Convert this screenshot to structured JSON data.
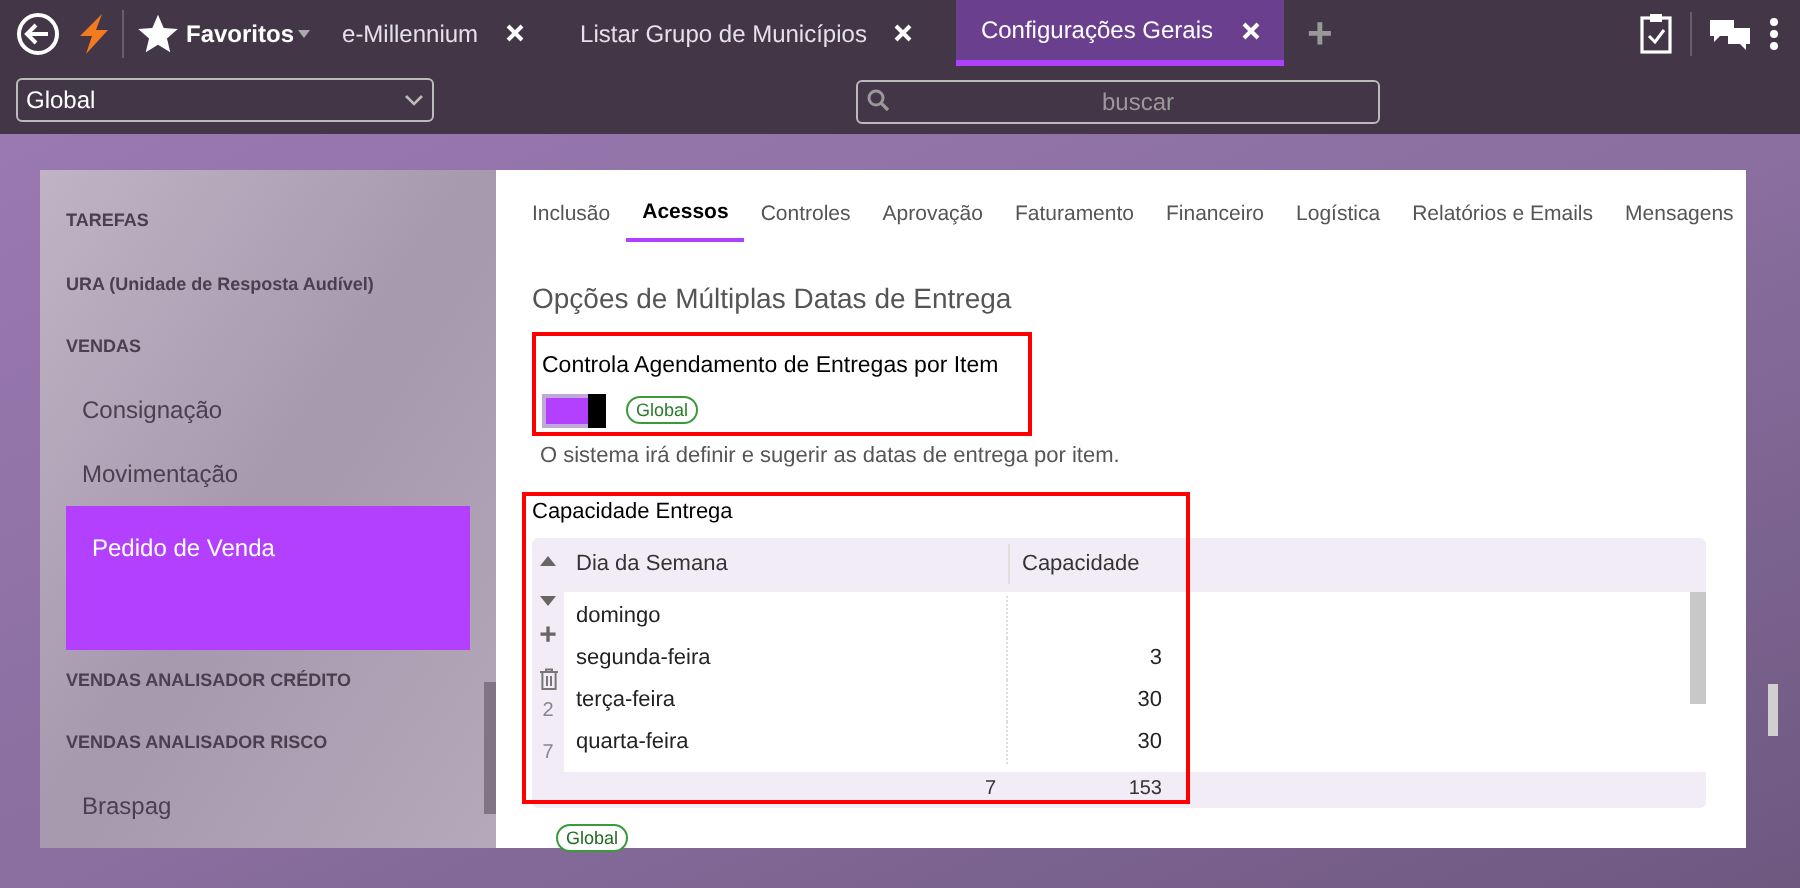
{
  "top_bar": {
    "favorites": "Favoritos",
    "tabs": [
      {
        "label": "e-Millennium",
        "selected": false
      },
      {
        "label": "Listar Grupo de Municípios",
        "selected": false
      },
      {
        "label": "Configurações Gerais",
        "selected": true
      }
    ],
    "add": "+"
  },
  "filter_bar": {
    "scope": "Global",
    "search": {
      "placeholder": "buscar"
    }
  },
  "sidebar": {
    "items": [
      {
        "kind": "header",
        "label": "TAREFAS",
        "selected": false
      },
      {
        "kind": "header",
        "label": "URA (Unidade de Resposta Audível)",
        "selected": false
      },
      {
        "kind": "header",
        "label": "VENDAS",
        "selected": false
      },
      {
        "kind": "item",
        "label": "Consignação",
        "selected": false
      },
      {
        "kind": "item",
        "label": "Movimentação",
        "selected": false
      },
      {
        "kind": "item",
        "label": "Pedido de Venda",
        "selected": true
      },
      {
        "kind": "header",
        "label": "VENDAS ANALISADOR CRÉDITO",
        "selected": false
      },
      {
        "kind": "header",
        "label": "VENDAS ANALISADOR RISCO",
        "selected": false
      },
      {
        "kind": "item",
        "label": "Braspag",
        "selected": false
      }
    ]
  },
  "tabs": [
    {
      "label": "Inclusão",
      "selected": false
    },
    {
      "label": "Acessos",
      "selected": true
    },
    {
      "label": "Controles",
      "selected": false
    },
    {
      "label": "Aprovação",
      "selected": false
    },
    {
      "label": "Faturamento",
      "selected": false
    },
    {
      "label": "Financeiro",
      "selected": false
    },
    {
      "label": "Logística",
      "selected": false
    },
    {
      "label": "Relatórios e Emails",
      "selected": false
    },
    {
      "label": "Mensagens",
      "selected": false
    }
  ],
  "section_title": "Opções de Múltiplas Datas de Entrega",
  "setting": {
    "label": "Controla Agendamento de Entregas por Item",
    "on": true,
    "scope": "Global",
    "highlighted": true,
    "description": "O sistema irá definir e sugerir as datas de entrega por item."
  },
  "capacity": {
    "label": "Capacidade Entrega",
    "highlighted": true,
    "add_row": "+",
    "side_count": "2",
    "columns": [
      "Dia da Semana",
      "Capacidade"
    ],
    "rows": [
      {
        "day": "domingo",
        "capacity": ""
      },
      {
        "day": "segunda-feira",
        "capacity": "3"
      },
      {
        "day": "terça-feira",
        "capacity": "30"
      },
      {
        "day": "quarta-feira",
        "capacity": "30"
      }
    ],
    "footer": {
      "row_count": "7",
      "count": "7",
      "total": "153"
    },
    "scope": "Global"
  }
}
